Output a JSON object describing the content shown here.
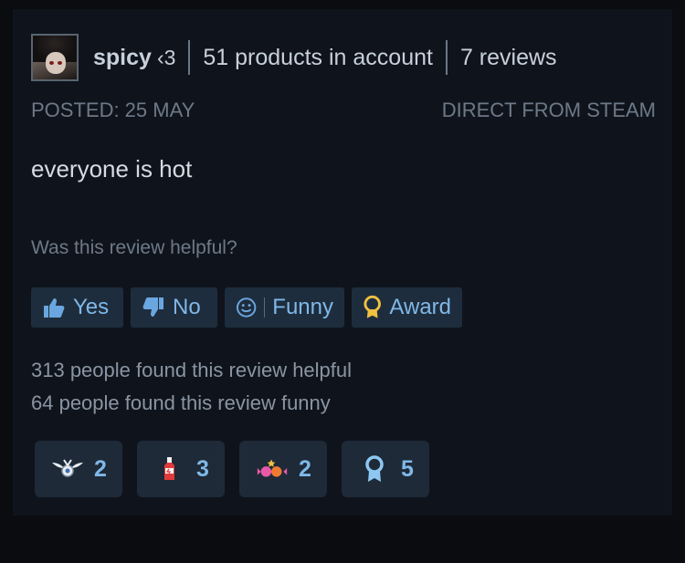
{
  "header": {
    "username": "spicy",
    "heart": "‹3",
    "products": "51 products in account",
    "reviews": "7 reviews"
  },
  "posted": {
    "date": "POSTED: 25 MAY",
    "source": "DIRECT FROM STEAM"
  },
  "review": {
    "text": "everyone is hot"
  },
  "helpful": {
    "question": "Was this review helpful?",
    "buttons": [
      {
        "label": "Yes",
        "icon": "thumbs-up-icon"
      },
      {
        "label": "No",
        "icon": "thumbs-down-icon"
      },
      {
        "label": "Funny",
        "icon": "smiley-icon"
      },
      {
        "label": "Award",
        "icon": "award-ribbon-icon"
      }
    ],
    "helpful_count": "313 people found this review helpful",
    "funny_count": "64 people found this review funny"
  },
  "awards": [
    {
      "icon": "winged-medal-icon",
      "count": "2"
    },
    {
      "icon": "hot-sauce-icon",
      "count": "3"
    },
    {
      "icon": "party-candy-icon",
      "count": "2"
    },
    {
      "icon": "ribbon-medal-icon",
      "count": "5"
    }
  ],
  "colors": {
    "background": "#0f141c",
    "button_bg": "#1e2d3d",
    "accent": "#7fb8e8",
    "muted": "#6e7987"
  }
}
